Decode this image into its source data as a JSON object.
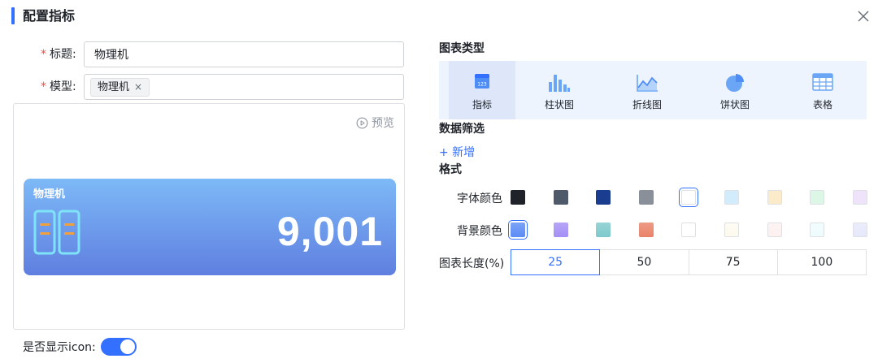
{
  "dialog": {
    "title": "配置指标"
  },
  "form": {
    "title_label": "标题:",
    "title_value": "物理机",
    "model_label": "模型:",
    "model_tag": "物理机",
    "required_mark": "*"
  },
  "preview": {
    "link_label": "预览",
    "card": {
      "title": "物理机",
      "value": "9,001"
    }
  },
  "toggle": {
    "label": "是否显示icon:",
    "on": true
  },
  "chart_type": {
    "section_title": "图表类型",
    "selected": "指标",
    "items": [
      {
        "label": "指标",
        "icon": "indicator-icon"
      },
      {
        "label": "柱状图",
        "icon": "bar-chart-icon"
      },
      {
        "label": "折线图",
        "icon": "line-chart-icon"
      },
      {
        "label": "饼状图",
        "icon": "pie-chart-icon"
      },
      {
        "label": "表格",
        "icon": "table-icon"
      }
    ]
  },
  "filter": {
    "section_title": "数据筛选",
    "add_label": "+ 新增"
  },
  "format": {
    "section_title": "格式",
    "font_color_label": "字体颜色",
    "bg_color_label": "背景颜色",
    "chart_length_label": "图表长度(%)",
    "font_colors": [
      "#1f2329",
      "#4e5969",
      "#1a3d8f",
      "#8a9099",
      "#ffffff",
      "#d3ecfc",
      "#fcebcb",
      "#dcf7e6",
      "#efe3fb"
    ],
    "font_color_selected": 4,
    "bg_colors": [
      "#5b8cf5",
      "#a58ff5",
      "#7ec9cc",
      "#e98268",
      "#ffffff",
      "#fdfaef",
      "#fdf1f0",
      "#eefcfd",
      "#e6e8fb"
    ],
    "bg_color_selected": 0,
    "lengths": [
      "25",
      "50",
      "75",
      "100"
    ],
    "length_selected": "25"
  },
  "colors": {
    "accent": "#3370ff",
    "required": "#f54a45",
    "card_top": "#7db9f7",
    "card_bottom": "#5f7fe0",
    "card_icon": "#7fe3f7",
    "card_icon_dash": "#f2a13a"
  }
}
